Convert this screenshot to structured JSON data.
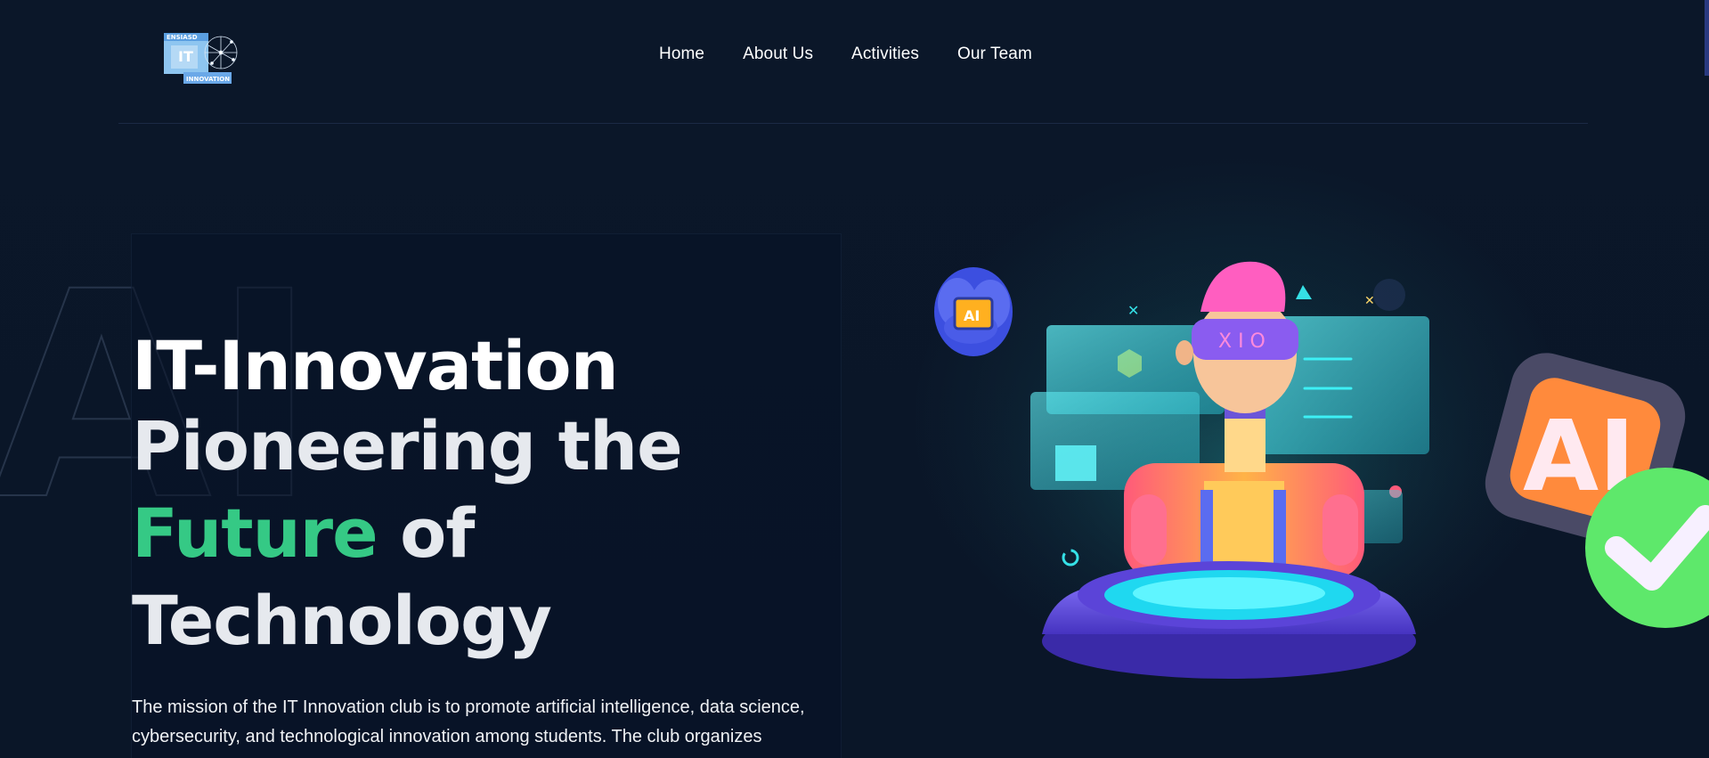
{
  "brand": {
    "logo_top_text": "ENSIASD",
    "logo_mid_text": "IT",
    "logo_bottom_text": "INNOVATION"
  },
  "nav": {
    "items": [
      {
        "label": "Home"
      },
      {
        "label": "About Us"
      },
      {
        "label": "Activities"
      },
      {
        "label": "Our Team"
      }
    ]
  },
  "background": {
    "watermark_text": "AI"
  },
  "hero": {
    "title_line1": "IT-Innovation",
    "title_line2": "Pioneering the",
    "title_accent": "Future",
    "title_of": " of",
    "title_line4": "Technology",
    "mission_text": "The mission of the IT Innovation club is to promote artificial intelligence, data science, cybersecurity, and technological innovation among students. The club organizes"
  },
  "illustration": {
    "brain_chip_label": "AI",
    "chip_badge_label": "AI",
    "visor_text": "X I O"
  },
  "colors": {
    "background": "#0a1628",
    "accent_green": "#35c985",
    "nav_text": "#ffffff",
    "hologram_cyan": "#35e0e6",
    "platform_purple": "#5b44d8"
  }
}
